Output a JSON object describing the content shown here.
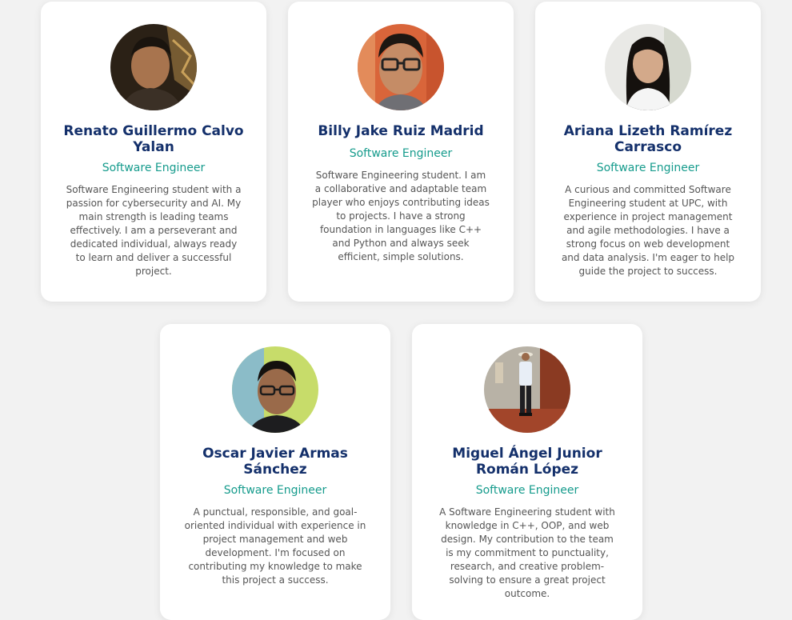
{
  "team": [
    {
      "name": "Renato Guillermo Calvo Yalan",
      "role": "Software Engineer",
      "bio": "Software Engineering student with a passion for cybersecurity and AI. My main strength is leading teams effectively. I am a perseverant and dedicated individual, always ready to learn and deliver a successful project.",
      "photo": "profile-photo"
    },
    {
      "name": "Billy Jake Ruiz Madrid",
      "role": "Software Engineer",
      "bio": "Software Engineering student. I am a collaborative and adaptable team player who enjoys contributing ideas to projects. I have a strong foundation in languages like C++ and Python and always seek efficient, simple solutions.",
      "photo": "profile-photo"
    },
    {
      "name": "Ariana Lizeth Ramírez Carrasco",
      "role": "Software Engineer",
      "bio": "A curious and committed Software Engineering student at UPC, with experience in project management and agile methodologies. I have a strong focus on web development and data analysis. I'm eager to help guide the project to success.",
      "photo": "profile-photo"
    },
    {
      "name": "Oscar Javier Armas Sánchez",
      "role": "Software Engineer",
      "bio": "A punctual, responsible, and goal-oriented individual with experience in project management and web development. I'm focused on contributing my knowledge to make this project a success.",
      "photo": "profile-photo"
    },
    {
      "name": "Miguel Ángel Junior Román López",
      "role": "Software Engineer",
      "bio": "A Software Engineering student with knowledge in C++, OOP, and web design. My contribution to the team is my commitment to punctuality, research, and creative problem-solving to ensure a great project outcome.",
      "photo": "profile-photo"
    }
  ],
  "colors": {
    "name": "#14306b",
    "role": "#159b8c",
    "bio": "#555555",
    "card": "#ffffff",
    "background": "#f2f2f2"
  }
}
